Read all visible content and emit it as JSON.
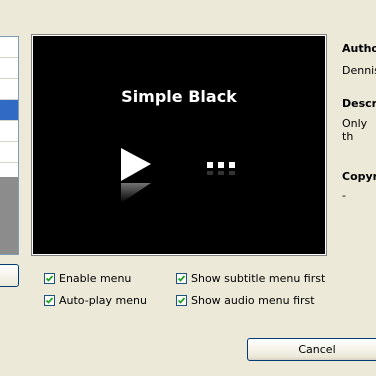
{
  "preview": {
    "title": "Simple Black"
  },
  "info": {
    "author_label": "Autho",
    "author_value": "Dennis",
    "description_label": "Descri",
    "description_value": "Only th",
    "copyright_label": "Copyri",
    "copyright_value": "-"
  },
  "options": {
    "enable_menu": "Enable menu",
    "autoplay_menu": "Auto-play menu",
    "show_subtitle_first": "Show subtitle menu first",
    "show_audio_first": "Show audio menu first"
  },
  "buttons": {
    "cancel": "Cancel"
  },
  "colors": {
    "dialog_bg": "#ece9d8",
    "selection": "#316ac5",
    "check": "#21a121"
  }
}
